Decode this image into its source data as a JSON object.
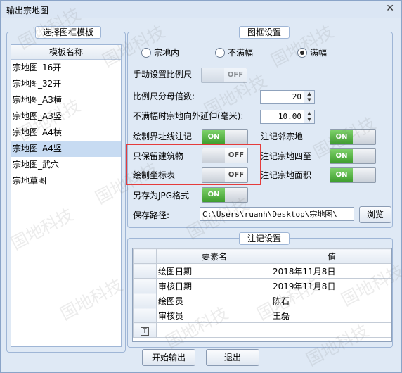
{
  "window": {
    "title": "输出宗地图",
    "close_glyph": "✕"
  },
  "template_panel": {
    "title": "选择图框模板",
    "column_header": "模板名称",
    "items": [
      "宗地图_16开",
      "宗地图_32开",
      "宗地图_A3横",
      "宗地图_A3竖",
      "宗地图_A4横",
      "宗地图_A4竖",
      "宗地图_武穴",
      "宗地草图"
    ],
    "selected": "宗地图_A4竖"
  },
  "frame_settings": {
    "title": "图框设置",
    "radio_options": [
      "宗地内",
      "不满幅",
      "满幅"
    ],
    "radio_selected": "满幅",
    "manual_scale_label": "手动设置比例尺",
    "scale_multiple_label": "比例尺分母倍数:",
    "scale_multiple_value": "20",
    "extend_label": "不满幅时宗地向外延伸(毫米):",
    "extend_value": "10.00",
    "draw_boundary_label": "绘制界址线注记",
    "annotate_neighbor_label": "注记邻宗地",
    "keep_buildings_label": "只保留建筑物",
    "annotate_four_label": "注记宗地四至",
    "draw_coords_label": "绘制坐标表",
    "annotate_area_label": "注记宗地面积",
    "save_jpg_label": "另存为JPG格式",
    "save_path_label": "保存路径:",
    "save_path_value": "C:\\Users\\ruanh\\Desktop\\宗地图\\",
    "browse_label": "浏览",
    "toggles": {
      "manual_scale": "OFF",
      "draw_boundary": "ON",
      "annotate_neighbor": "ON",
      "keep_buildings": "OFF",
      "annotate_four": "ON",
      "draw_coords": "OFF",
      "annotate_area": "ON",
      "save_jpg": "ON"
    }
  },
  "annotation_settings": {
    "title": "注记设置",
    "columns": [
      "要素名",
      "值"
    ],
    "rows": [
      {
        "name": "绘图日期",
        "value": "2018年11月8日"
      },
      {
        "name": "审核日期",
        "value": "2019年11月8日"
      },
      {
        "name": "绘图员",
        "value": "陈石"
      },
      {
        "name": "审核员",
        "value": "王磊"
      }
    ],
    "new_row_glyph": "T"
  },
  "buttons": {
    "start": "开始输出",
    "exit": "退出"
  },
  "watermark_text": "国地科技",
  "colors": {
    "highlight": "#e53b3b",
    "toggle_on": "#3d9c2d"
  }
}
